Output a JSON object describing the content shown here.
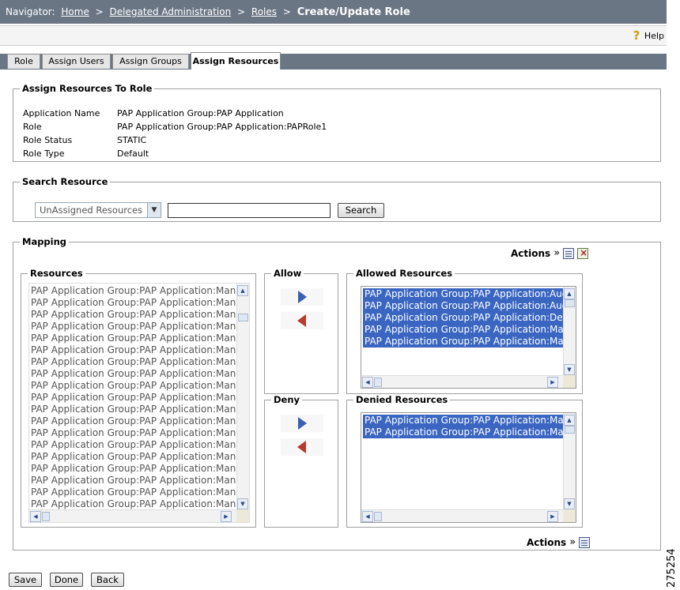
{
  "navigator": {
    "label": "Navigator:",
    "crumbs": [
      "Home",
      "Delegated Administration",
      "Roles"
    ],
    "separator": ">",
    "current": "Create/Update Role"
  },
  "help": {
    "label": "Help"
  },
  "tabs": [
    {
      "label": "Role"
    },
    {
      "label": "Assign Users"
    },
    {
      "label": "Assign Groups"
    },
    {
      "label": "Assign Resources"
    }
  ],
  "assign_box": {
    "title": "Assign Resources To Role",
    "rows": [
      {
        "label": "Application Name",
        "value": "PAP Application Group:PAP Application"
      },
      {
        "label": "Role",
        "value": "PAP Application Group:PAP Application:PAPRole1"
      },
      {
        "label": "Role Status",
        "value": "STATIC"
      },
      {
        "label": "Role Type",
        "value": "Default"
      }
    ]
  },
  "search_box": {
    "title": "Search Resource",
    "select_value": "UnAssigned Resources",
    "input_value": "",
    "button": "Search"
  },
  "mapping": {
    "title": "Mapping",
    "actions_label": "Actions",
    "actions_sep": "»",
    "resources": {
      "title": "Resources",
      "items": [
        "PAP Application Group:PAP Application:Manage",
        "PAP Application Group:PAP Application:Manage",
        "PAP Application Group:PAP Application:Manage",
        "PAP Application Group:PAP Application:Manage",
        "PAP Application Group:PAP Application:Manage",
        "PAP Application Group:PAP Application:Manage",
        "PAP Application Group:PAP Application:Manage",
        "PAP Application Group:PAP Application:Manage",
        "PAP Application Group:PAP Application:Manage",
        "PAP Application Group:PAP Application:Manage",
        "PAP Application Group:PAP Application:Manage",
        "PAP Application Group:PAP Application:Manage",
        "PAP Application Group:PAP Application:Manage",
        "PAP Application Group:PAP Application:Manage",
        "PAP Application Group:PAP Application:Manage",
        "PAP Application Group:PAP Application:Manage",
        "PAP Application Group:PAP Application:Manage",
        "PAP Application Group:PAP Application:Manage",
        "PAP Application Group:PAP Application:Manage"
      ]
    },
    "allow": {
      "title": "Allow"
    },
    "deny": {
      "title": "Deny"
    },
    "allowed": {
      "title": "Allowed Resources",
      "items": [
        "PAP Application Group:PAP Application:Auditing",
        "PAP Application Group:PAP Application:Auditing",
        "PAP Application Group:PAP Application:Delegated",
        "PAP Application Group:PAP Application:Manage",
        "PAP Application Group:PAP Application:Manage"
      ]
    },
    "denied": {
      "title": "Denied Resources",
      "items": [
        "PAP Application Group:PAP Application:Manage",
        "PAP Application Group:PAP Application:Manage"
      ]
    }
  },
  "footer_buttons": {
    "save": "Save",
    "done": "Done",
    "back": "Back"
  },
  "figure_number": "275254",
  "colors": {
    "nav_bg": "#6b7685",
    "selection": "#3a66c2",
    "allow_arrow": "#3b5fb3",
    "deny_arrow": "#b63a2e"
  }
}
